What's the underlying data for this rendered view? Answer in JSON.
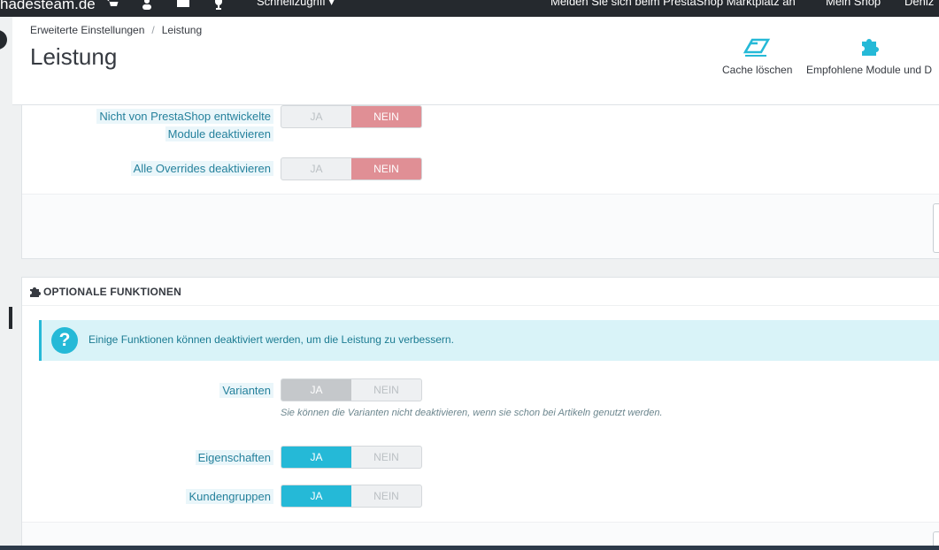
{
  "topbar": {
    "brand": "hadesteam.de",
    "quick_access": "Schnellzugriff ▾",
    "marketplace": "Melden Sie sich beim PrestaShop Marktplatz an",
    "my_shop": "Mein Shop",
    "user": "Deniz"
  },
  "header": {
    "breadcrumb": [
      "Erweiterte Einstellungen",
      "Leistung"
    ],
    "title": "Leistung",
    "toolbar": {
      "clear_cache": "Cache löschen",
      "recommended_modules": "Empfohlene Module und D"
    }
  },
  "debug_panel": {
    "rows": [
      {
        "label_line1": "Nicht von PrestaShop entwickelte",
        "label_line2": "Module deaktivieren",
        "yes": "JA",
        "no": "NEIN",
        "value": "NEIN"
      },
      {
        "label": "Alle Overrides deaktivieren",
        "yes": "JA",
        "no": "NEIN",
        "value": "NEIN"
      }
    ]
  },
  "optional_panel": {
    "heading": "OPTIONALE FUNKTIONEN",
    "alert": "Einige Funktionen können deaktiviert werden, um die Leistung zu verbessern.",
    "rows": [
      {
        "label": "Varianten",
        "yes": "JA",
        "no": "NEIN",
        "value": "JA",
        "disabled": true,
        "help": "Sie können die Varianten nicht deaktivieren, wenn sie schon bei Artikeln genutzt werden."
      },
      {
        "label": "Eigenschaften",
        "yes": "JA",
        "no": "NEIN",
        "value": "JA"
      },
      {
        "label": "Kundengruppen",
        "yes": "JA",
        "no": "NEIN",
        "value": "JA"
      }
    ]
  },
  "colors": {
    "accent": "#25b9d7",
    "off_red": "#e08f95",
    "navbar": "#25292e"
  }
}
